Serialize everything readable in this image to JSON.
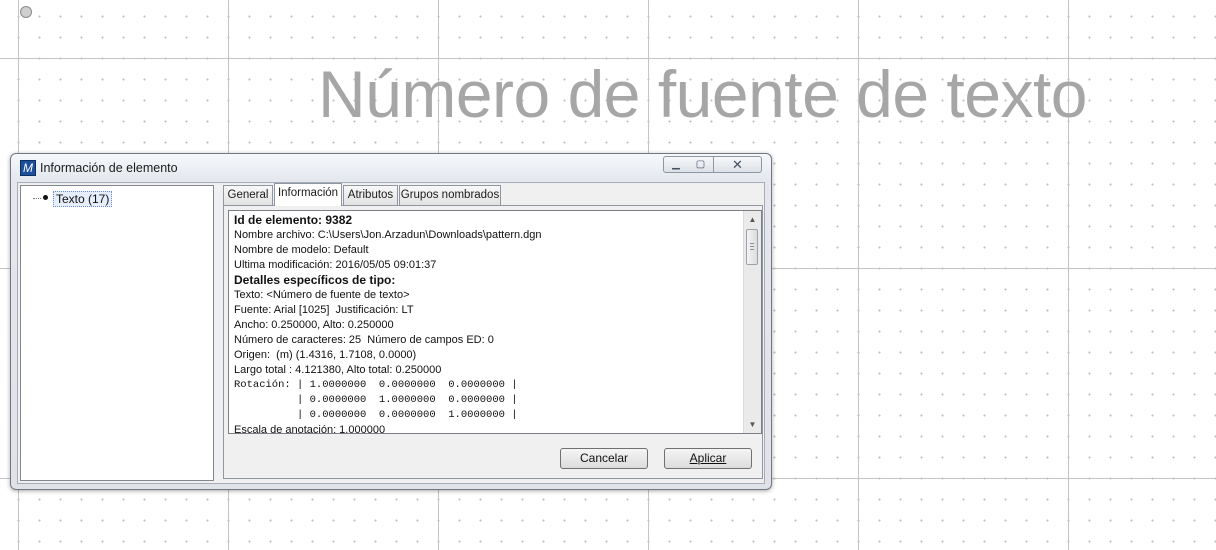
{
  "canvas": {
    "text": "Número de fuente de texto"
  },
  "dialog": {
    "title": "Información de elemento",
    "icons": {
      "app": "app-icon",
      "minimize": "minimize-icon",
      "maximize": "maximize-icon",
      "close": "close-icon"
    },
    "tree": {
      "items": [
        {
          "label": "Texto (17)"
        }
      ]
    },
    "tabs": [
      {
        "label": "General",
        "active": false
      },
      {
        "label": "Información",
        "active": true
      },
      {
        "label": "Atributos",
        "active": false
      },
      {
        "label": "Grupos nombrados",
        "active": false
      }
    ],
    "info": {
      "lines": [
        {
          "text": "Id de elemento: 9382",
          "style": "bold"
        },
        {
          "text": "Nombre archivo: C:\\Users\\Jon.Arzadun\\Downloads\\pattern.dgn",
          "style": "normal"
        },
        {
          "text": "Nombre de modelo: Default",
          "style": "normal"
        },
        {
          "text": "Ultima modificación: 2016/05/05 09:01:37",
          "style": "normal"
        },
        {
          "text": "Detalles específicos de tipo:",
          "style": "bold"
        },
        {
          "text": "Texto: <Número de fuente de texto>",
          "style": "normal"
        },
        {
          "text": "Fuente: Arial [1025]  Justificación: LT",
          "style": "normal"
        },
        {
          "text": "Ancho: 0.250000, Alto: 0.250000",
          "style": "normal"
        },
        {
          "text": "Número de caracteres: 25  Número de campos ED: 0",
          "style": "normal"
        },
        {
          "text": "Origen:  (m) (1.4316, 1.7108, 0.0000)",
          "style": "normal"
        },
        {
          "text": "Largo total : 4.121380, Alto total: 0.250000",
          "style": "normal"
        },
        {
          "text": "Rotación: | 1.0000000  0.0000000  0.0000000 |",
          "style": "mono"
        },
        {
          "text": "          | 0.0000000  1.0000000  0.0000000 |",
          "style": "mono"
        },
        {
          "text": "          | 0.0000000  0.0000000  1.0000000 |",
          "style": "mono"
        },
        {
          "text": "Escala de anotación: 1.000000",
          "style": "normal"
        }
      ]
    },
    "buttons": {
      "cancel": "Cancelar",
      "apply": "Aplicar"
    }
  }
}
